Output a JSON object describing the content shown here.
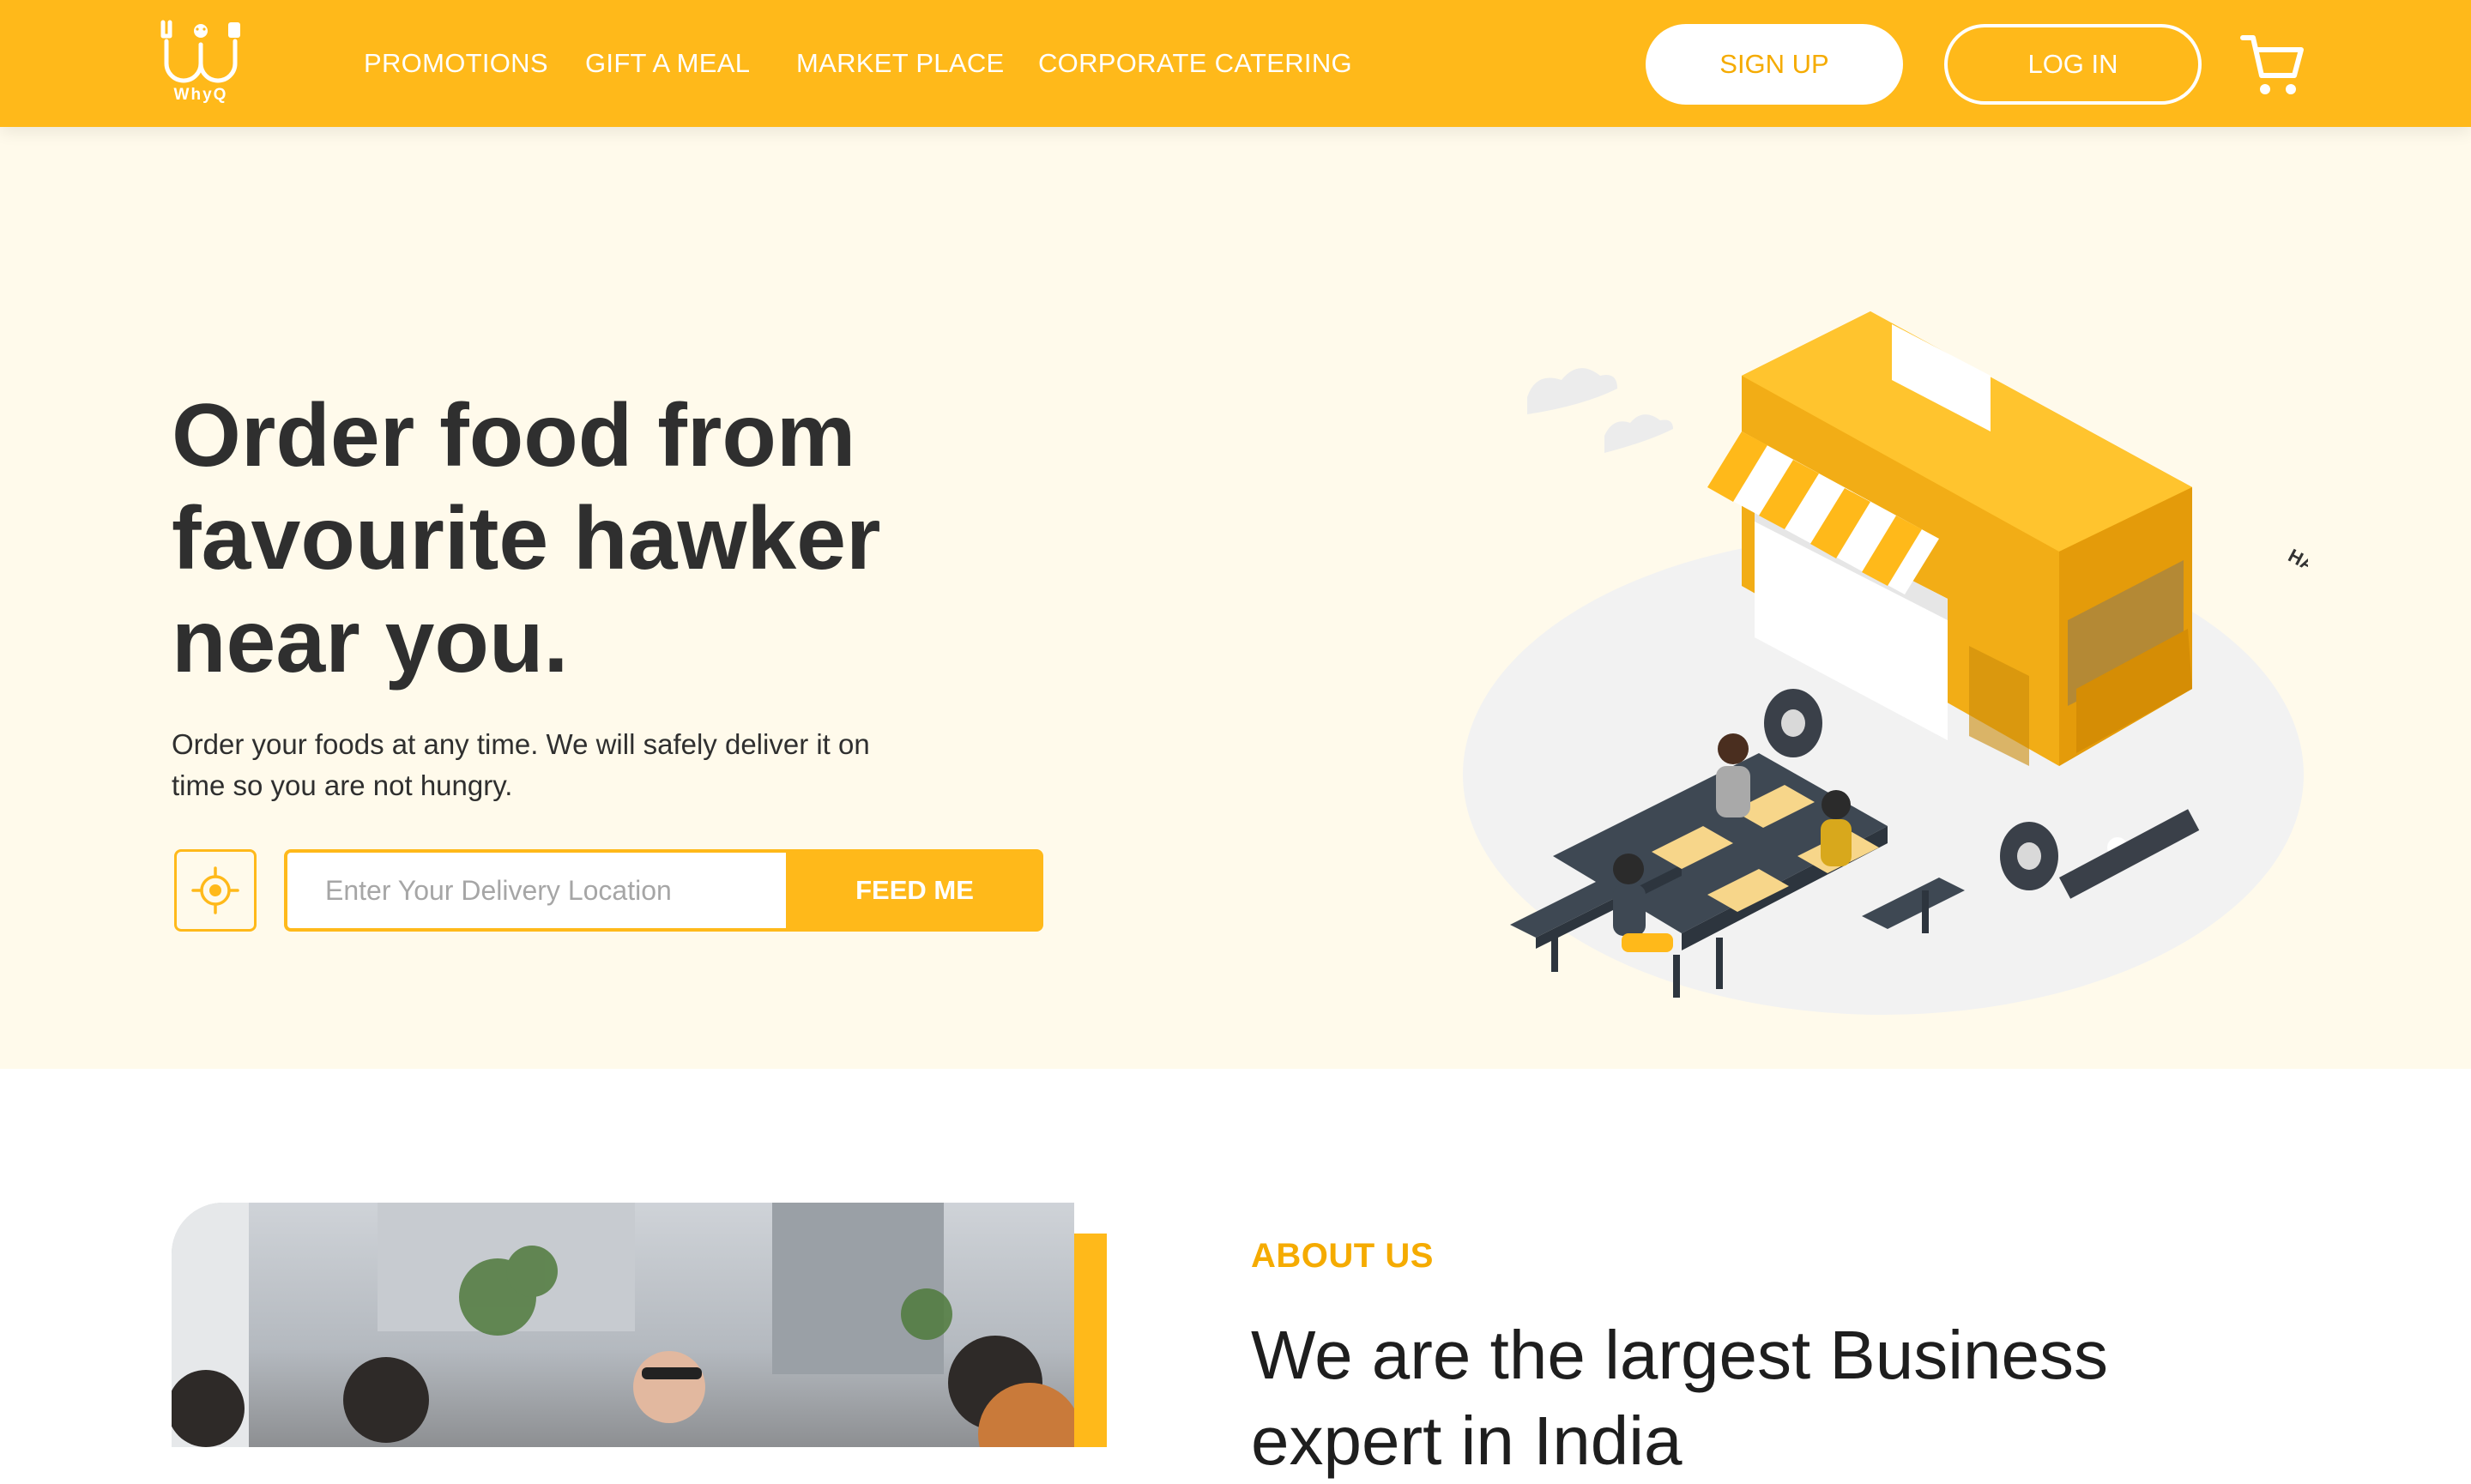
{
  "header": {
    "logo_text": "WhyQ",
    "nav": [
      {
        "label": "PROMOTIONS"
      },
      {
        "label": "GIFT A MEAL"
      },
      {
        "label": "MARKET PLACE"
      },
      {
        "label": "CORPORATE CATERING"
      }
    ],
    "signup_label": "SIGN UP",
    "login_label": "LOG IN",
    "cart_icon": "shopping-cart-icon"
  },
  "hero": {
    "title": "Order food from favourite hawker near you.",
    "subtitle": "Order your foods at any time. We will safely deliver it on time so you are not hungry.",
    "location_placeholder": "Enter Your Delivery Location",
    "feed_button": "FEED ME",
    "locate_icon": "crosshair-icon",
    "illustration": {
      "truck_sign": "HAWKER FOOD"
    }
  },
  "about": {
    "label": "ABOUT US",
    "title": "We are the largest Business expert in India"
  },
  "colors": {
    "brand": "#ffb91a",
    "hero_bg": "#fffaeb",
    "text_dark": "#2f2f2f"
  }
}
